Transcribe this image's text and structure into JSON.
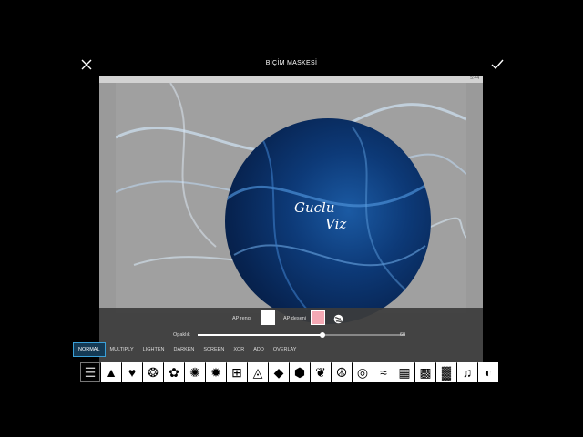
{
  "header": {
    "title": "BİÇİM MASKESİ",
    "close_icon": "close-icon",
    "confirm_icon": "check-icon"
  },
  "canvas": {
    "logo_line1": "Guclu",
    "logo_line2": "Viz",
    "status_text": "5:44"
  },
  "controls": {
    "bg_color_label": "AP rengi",
    "bg_pattern_label": "AP deseni",
    "opacity_label": "Opaklık",
    "opacity_value": "60",
    "opacity_fraction": 0.6,
    "bg_color": "#ffffff",
    "pattern_color": "#f4a8b4"
  },
  "blend_modes": [
    "NORMAL",
    "MULTIPLY",
    "LIGHTEN",
    "DARKEN",
    "SCREEN",
    "XOR",
    "ADD",
    "OVERLAY"
  ],
  "active_mode": "NORMAL",
  "shapes": [
    {
      "name": "adjust-icon",
      "glyph": "☰"
    },
    {
      "name": "triangle-icon",
      "glyph": "▲"
    },
    {
      "name": "heart-icon",
      "glyph": "♥"
    },
    {
      "name": "mandala-icon",
      "glyph": "❂"
    },
    {
      "name": "flower-icon",
      "glyph": "✿"
    },
    {
      "name": "rosette-icon",
      "glyph": "✺"
    },
    {
      "name": "sun-icon",
      "glyph": "✹"
    },
    {
      "name": "spiral-icon",
      "glyph": "⊞"
    },
    {
      "name": "triangle-pattern-icon",
      "glyph": "◬"
    },
    {
      "name": "diamond-icon",
      "glyph": "◆"
    },
    {
      "name": "hexagon-icon",
      "glyph": "⬢"
    },
    {
      "name": "double-heart-icon",
      "glyph": "❦"
    },
    {
      "name": "peace-icon",
      "glyph": "☮"
    },
    {
      "name": "circles-icon",
      "glyph": "◎"
    },
    {
      "name": "wave-icon",
      "glyph": "≈"
    },
    {
      "name": "grid-icon",
      "glyph": "▦"
    },
    {
      "name": "dots-icon",
      "glyph": "▩"
    },
    {
      "name": "noise-icon",
      "glyph": "▓"
    },
    {
      "name": "music-icon",
      "glyph": "♫"
    },
    {
      "name": "partial-circle-icon",
      "glyph": "◐"
    }
  ]
}
